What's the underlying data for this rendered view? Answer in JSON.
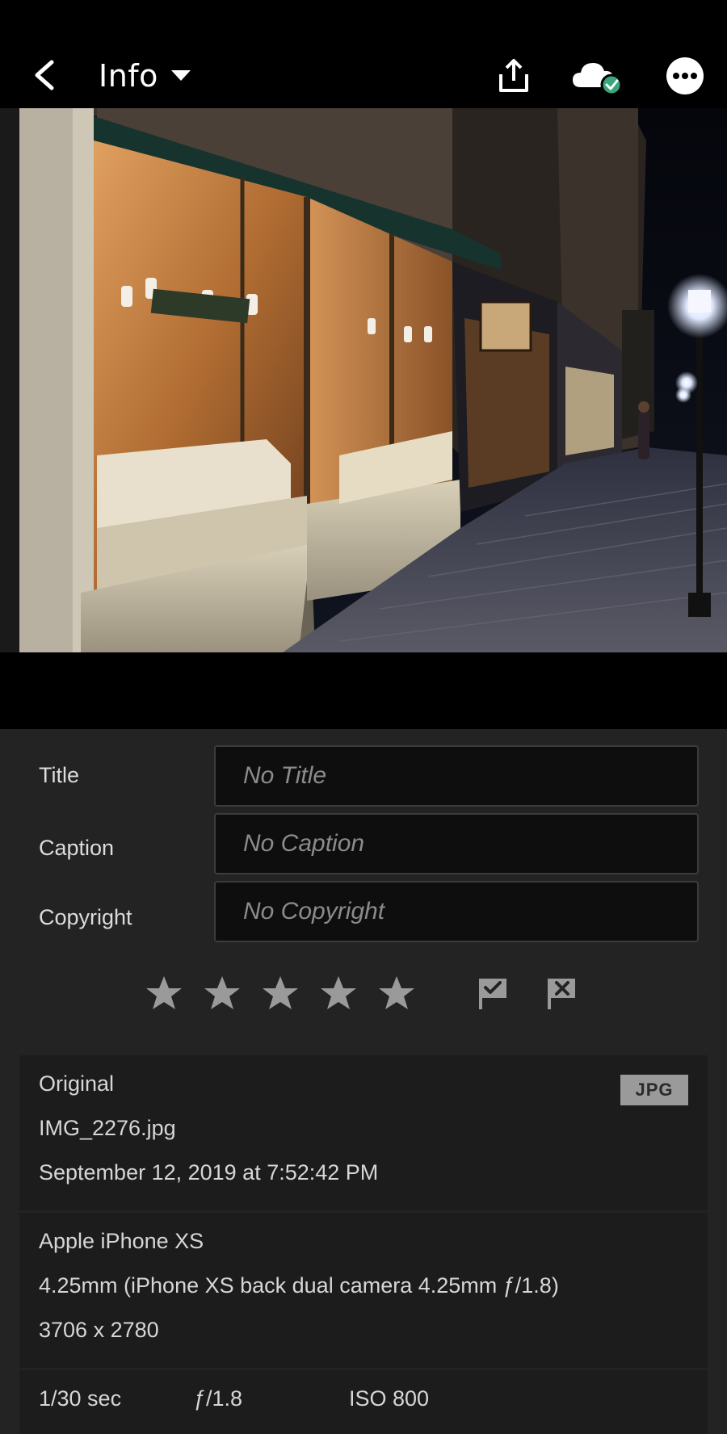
{
  "header": {
    "title": "Info"
  },
  "fields": {
    "title_label": "Title",
    "title_placeholder": "No Title",
    "caption_label": "Caption",
    "caption_placeholder": "No Caption",
    "copyright_label": "Copyright",
    "copyright_placeholder": "No Copyright"
  },
  "rating": {
    "stars": 0,
    "max_stars": 5
  },
  "file": {
    "section_label": "Original",
    "filename": "IMG_2276.jpg",
    "datetime": "September 12, 2019 at 7:52:42 PM",
    "format_badge": "JPG"
  },
  "camera": {
    "model": "Apple iPhone XS",
    "lens": "4.25mm (iPhone XS back dual camera 4.25mm ƒ/1.8)",
    "dimensions": "3706 x 2780"
  },
  "exposure": {
    "shutter": "1/30 sec",
    "aperture": "ƒ/1.8",
    "iso": "ISO 800"
  },
  "icons": {
    "back": "chevron-left-icon",
    "dropdown": "caret-down-icon",
    "share": "share-icon",
    "cloud": "cloud-synced-icon",
    "more": "more-icon",
    "star": "star-icon",
    "pick": "flag-pick-icon",
    "reject": "flag-reject-icon"
  },
  "colors": {
    "sync_ok": "#3aa57a",
    "panel_bg": "#232323",
    "input_bg": "#0e0e0e"
  }
}
